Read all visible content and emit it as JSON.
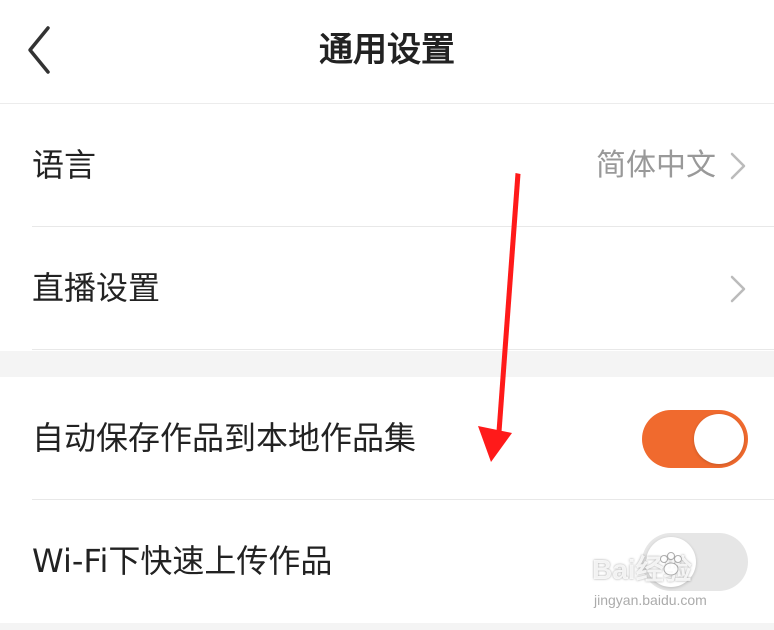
{
  "header": {
    "title": "通用设置",
    "back_icon": "chevron-left-icon"
  },
  "settings": {
    "language": {
      "label": "语言",
      "value": "简体中文",
      "icon": "chevron-right-icon"
    },
    "live": {
      "label": "直播设置",
      "icon": "chevron-right-icon"
    },
    "auto_save": {
      "label": "自动保存作品到本地作品集",
      "enabled": true
    },
    "wifi_upload": {
      "label": "Wi-Fi下快速上传作品",
      "enabled": false
    }
  },
  "colors": {
    "accent": "#f06a2e",
    "annotation": "#ff1a1a",
    "toggle_off": "#e6e6e6"
  },
  "watermark": {
    "main": "Bai经验",
    "sub": "jingyan.baidu.com"
  }
}
